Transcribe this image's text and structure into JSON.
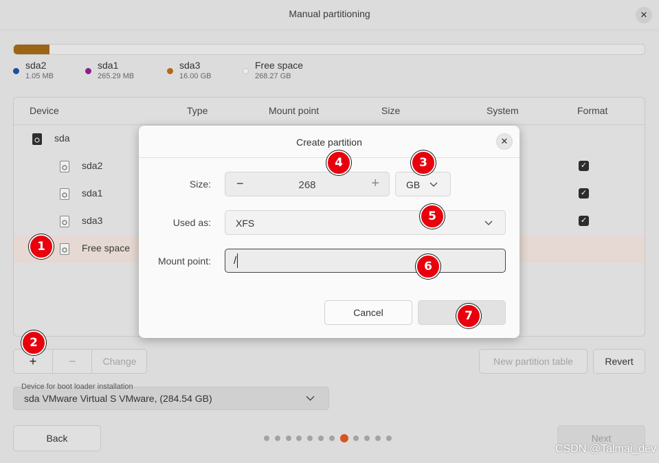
{
  "window": {
    "title": "Manual partitioning"
  },
  "usage_bar": {
    "segments": [
      {
        "name": "sda2",
        "color": "#1d4e9e",
        "fraction": 3.7e-06
      },
      {
        "name": "sda1",
        "color": "#9b1e9b",
        "fraction": 0.00093
      },
      {
        "name": "sda3",
        "color": "#9b6515",
        "fraction": 0.0562
      },
      {
        "name": "Free space",
        "color": "#e3e3e3",
        "fraction": 0.9428
      }
    ]
  },
  "legend": [
    {
      "name": "sda2",
      "size": "1.05 MB",
      "color": "#1d4e9e"
    },
    {
      "name": "sda1",
      "size": "265.29 MB",
      "color": "#8e1e8e"
    },
    {
      "name": "sda3",
      "size": "16.00 GB",
      "color": "#b06b12"
    },
    {
      "name": "Free space",
      "size": "268.27 GB",
      "color": "#ececec"
    }
  ],
  "table": {
    "headers": [
      "Device",
      "Type",
      "Mount point",
      "Size",
      "System",
      "Format"
    ],
    "rows": [
      {
        "label": "sda",
        "level": 0,
        "format_checked": false,
        "selected": false
      },
      {
        "label": "sda2",
        "level": 1,
        "format_checked": true,
        "selected": false
      },
      {
        "label": "sda1",
        "level": 1,
        "format_checked": true,
        "selected": false
      },
      {
        "label": "sda3",
        "level": 1,
        "format_checked": true,
        "selected": false
      },
      {
        "label": "Free space",
        "level": 1,
        "format_checked": false,
        "selected": true
      }
    ]
  },
  "toolbar": {
    "add": "+",
    "remove": "−",
    "change": "Change",
    "new_table": "New partition table",
    "revert": "Revert"
  },
  "boot": {
    "label": "Device for boot loader installation",
    "value": "sda VMware Virtual S VMware, (284.54 GB)"
  },
  "nav": {
    "back": "Back",
    "next": "Next",
    "pages": 12,
    "active_page": 8
  },
  "watermark": "CSDN @Talmai_dev",
  "dialog": {
    "title": "Create partition",
    "size_label": "Size:",
    "size_value": "268",
    "unit": "GB",
    "used_as_label": "Used as:",
    "used_as_value": "XFS",
    "mount_label": "Mount point:",
    "mount_value": "/",
    "cancel": "Cancel",
    "ok": ""
  },
  "badges": [
    "1",
    "2",
    "3",
    "4",
    "5",
    "6",
    "7"
  ],
  "icons": {
    "close": "close-icon",
    "chevron": "chevron-down-icon",
    "disk": "disk-icon"
  }
}
